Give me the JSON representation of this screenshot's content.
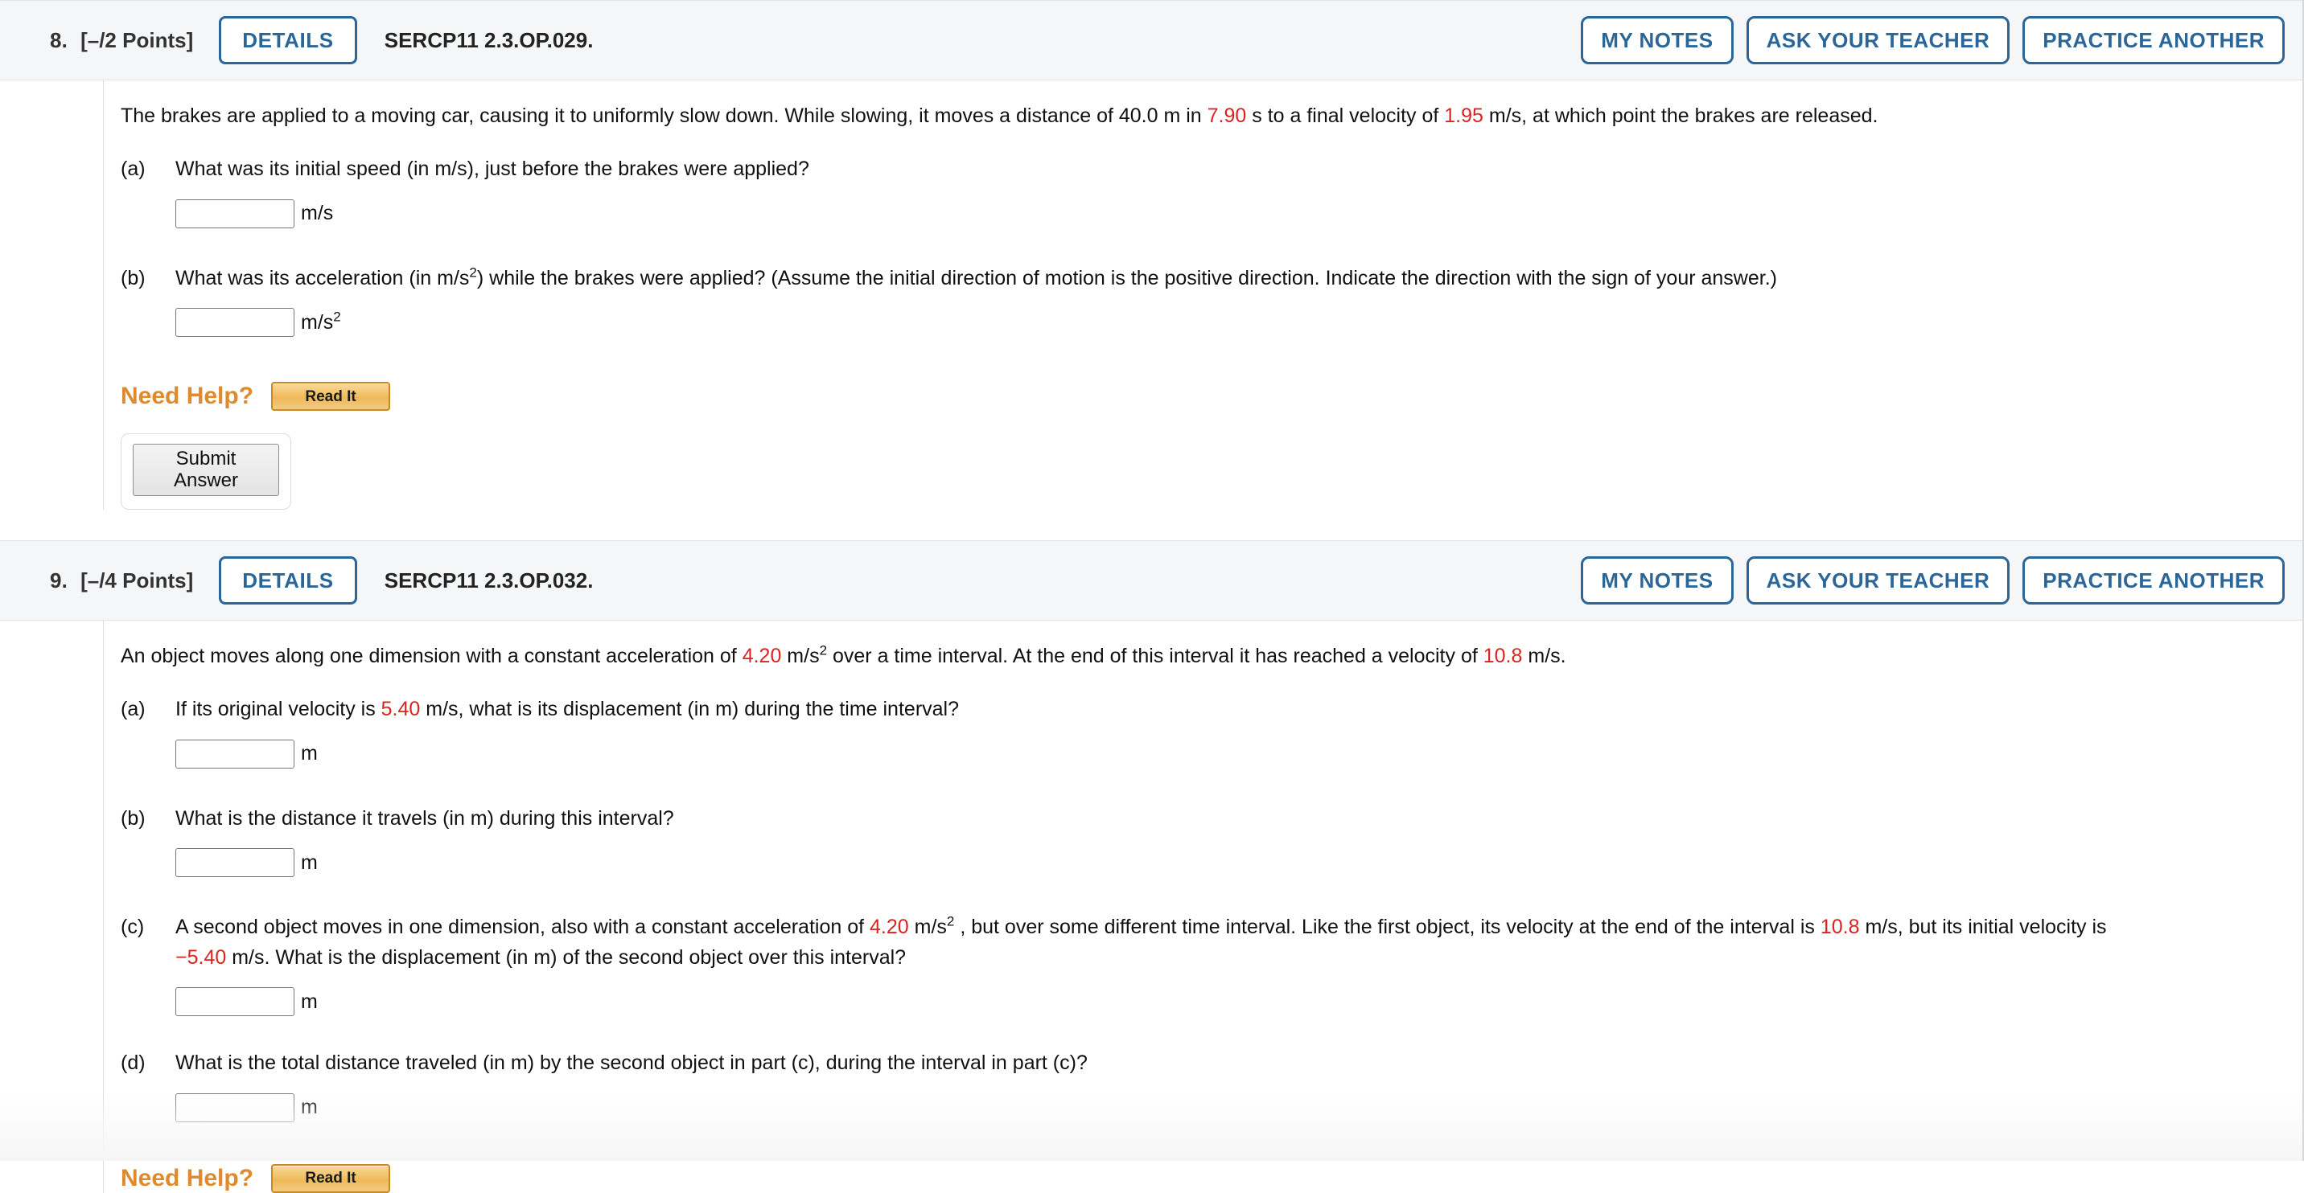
{
  "colors": {
    "accent_blue": "#2b6699",
    "value_red": "#d9241f",
    "need_help_orange": "#e08a2e",
    "header_bg": "#f5f6f7"
  },
  "questions": [
    {
      "number": "8.",
      "points": "[–/2 Points]",
      "details_label": "DETAILS",
      "code": "SERCP11 2.3.OP.029.",
      "actions": {
        "my_notes": "MY NOTES",
        "ask_teacher": "ASK YOUR TEACHER",
        "practice_another": "PRACTICE ANOTHER"
      },
      "stem": {
        "t1": "The brakes are applied to a moving car, causing it to uniformly slow down. While slowing, it moves a distance of 40.0 m in ",
        "v1": "7.90",
        "t2": " s to a final velocity of ",
        "v2": "1.95",
        "t3": " m/s, at which point the brakes are released."
      },
      "parts": [
        {
          "label": "(a)",
          "text": "What was its initial speed (in m/s), just before the brakes were applied?",
          "input_value": "",
          "unit": "m/s"
        },
        {
          "label": "(b)",
          "text_1": "What was its acceleration (in m/s",
          "exp": "2",
          "text_2": ") while the brakes were applied? (Assume the initial direction of motion is the positive direction. Indicate the direction with the sign of your answer.)",
          "input_value": "",
          "unit_base": "m/s",
          "unit_exp": "2"
        }
      ],
      "need_help_label": "Need Help?",
      "read_it_label": "Read It",
      "submit_label": "Submit Answer"
    },
    {
      "number": "9.",
      "points": "[–/4 Points]",
      "details_label": "DETAILS",
      "code": "SERCP11 2.3.OP.032.",
      "actions": {
        "my_notes": "MY NOTES",
        "ask_teacher": "ASK YOUR TEACHER",
        "practice_another": "PRACTICE ANOTHER"
      },
      "stem": {
        "t1": "An object moves along one dimension with a constant acceleration of ",
        "v1": "4.20",
        "t2": " m/s",
        "exp": "2",
        "t3": " over a time interval. At the end of this interval it has reached a velocity of ",
        "v2": "10.8",
        "t4": " m/s."
      },
      "parts": [
        {
          "label": "(a)",
          "text_1": "If its original velocity is ",
          "v1": "5.40",
          "text_2": " m/s, what is its displacement (in m) during the time interval?",
          "input_value": "",
          "unit": "m"
        },
        {
          "label": "(b)",
          "text_1": "What is the distance it travels (in m) during this interval?",
          "input_value": "",
          "unit": "m"
        },
        {
          "label": "(c)",
          "text_1": "A second object moves in one dimension, also with a constant acceleration of ",
          "v1": "4.20",
          "text_2": " m/s",
          "exp": "2",
          "text_3": " , but over some different time interval. Like the first object, its velocity at the end of the interval is ",
          "v2": "10.8",
          "text_4": " m/s, but its initial velocity is ",
          "v3": "−5.40",
          "text_5": " m/s. What is the displacement (in m) of the second object over this interval?",
          "input_value": "",
          "unit": "m"
        },
        {
          "label": "(d)",
          "text_1": "What is the total distance traveled (in m) by the second object in part (c), during the interval in part (c)?",
          "input_value": "",
          "unit": "m"
        }
      ],
      "need_help_label": "Need Help?",
      "read_it_label": "Read It"
    }
  ]
}
